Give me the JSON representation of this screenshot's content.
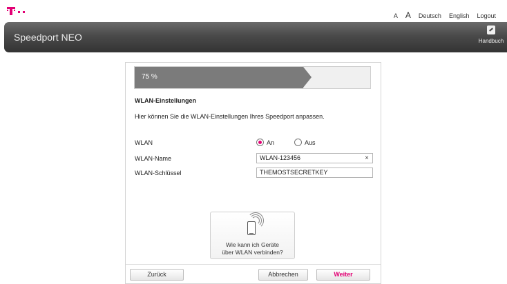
{
  "top_links": {
    "font_small": "A",
    "font_large": "A",
    "lang_de": "Deutsch",
    "lang_en": "English",
    "logout": "Logout"
  },
  "header": {
    "title": "Speedport NEO",
    "manual_label": "Handbuch",
    "manual_icon": "manual-icon"
  },
  "wizard": {
    "progress_label": "75 %",
    "progress_percent": 75,
    "section_title": "WLAN-Einstellungen",
    "description": "Hier können Sie die WLAN-Einstellungen Ihres Speedport anpassen.",
    "wlan": {
      "label": "WLAN",
      "option_on": "An",
      "option_off": "Aus",
      "selected": "An"
    },
    "name": {
      "label": "WLAN-Name",
      "value": "WLAN-123456",
      "clear_icon": "×"
    },
    "key": {
      "label": "WLAN-Schlüssel",
      "value": "THEMOSTSECRETKEY"
    },
    "help_card": {
      "icon": "phone-wifi-icon",
      "line1": "Wie kann ich Geräte",
      "line2": "über WLAN verbinden?"
    },
    "buttons": {
      "back": "Zurück",
      "cancel": "Abbrechen",
      "next": "Weiter"
    }
  },
  "colors": {
    "brand": "#e20074",
    "header_dark": "#333333",
    "progress_fill": "#7b7b7b"
  }
}
